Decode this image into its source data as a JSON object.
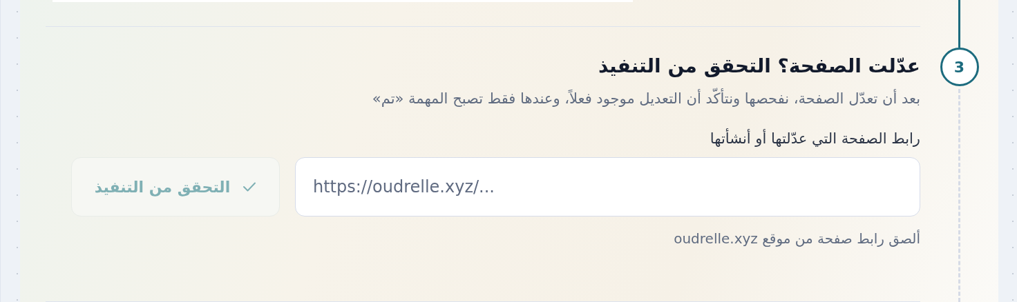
{
  "step": {
    "number": "3",
    "title": "عدّلت الصفحة؟ التحقق من التنفيذ",
    "description": "بعد أن تعدّل الصفحة، نفحصها ونتأكّد أن التعديل موجود فعلاً، وعندها فقط تصبح المهمة «تم»",
    "url_field": {
      "label": "رابط الصفحة التي عدّلتها أو أنشأتها",
      "placeholder": "https://oudrelle.xyz/...",
      "hint": "ألصق رابط صفحة من موقع oudrelle.xyz"
    },
    "verify_button": {
      "label": "التحقق من التنفيذ",
      "disabled": true
    }
  }
}
